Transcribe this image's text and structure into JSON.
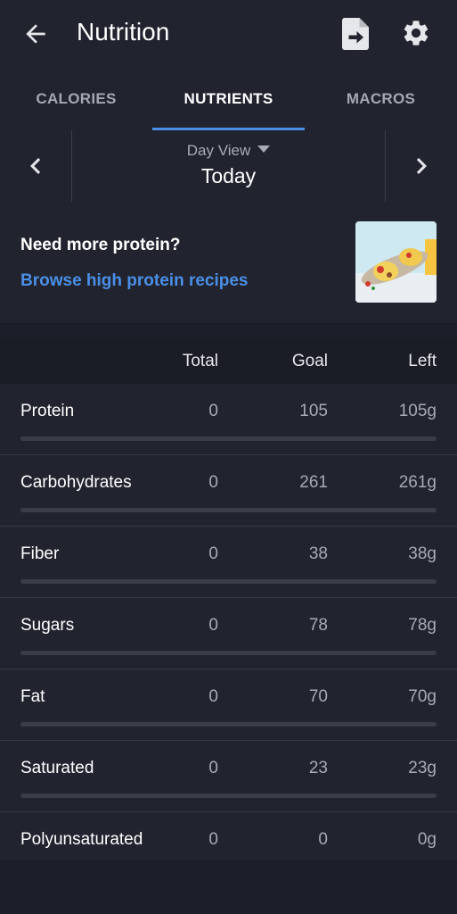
{
  "header": {
    "title": "Nutrition",
    "back_icon": "arrow-left-icon",
    "export_icon": "document-export-icon",
    "settings_icon": "gear-icon"
  },
  "tabs": [
    {
      "label": "CALORIES",
      "active": false
    },
    {
      "label": "NUTRIENTS",
      "active": true
    },
    {
      "label": "MACROS",
      "active": false
    }
  ],
  "day_selector": {
    "view_label": "Day View",
    "day": "Today"
  },
  "promo": {
    "question": "Need more protein?",
    "link": "Browse high protein recipes",
    "image": "breakfast-wrap-photo"
  },
  "table": {
    "headers": {
      "total": "Total",
      "goal": "Goal",
      "left": "Left"
    },
    "rows": [
      {
        "name": "Protein",
        "total": "0",
        "goal": "105",
        "left": "105g",
        "progress": 0
      },
      {
        "name": "Carbohydrates",
        "total": "0",
        "goal": "261",
        "left": "261g",
        "progress": 0
      },
      {
        "name": "Fiber",
        "total": "0",
        "goal": "38",
        "left": "38g",
        "progress": 0
      },
      {
        "name": "Sugars",
        "total": "0",
        "goal": "78",
        "left": "78g",
        "progress": 0
      },
      {
        "name": "Fat",
        "total": "0",
        "goal": "70",
        "left": "70g",
        "progress": 0
      },
      {
        "name": "Saturated",
        "total": "0",
        "goal": "23",
        "left": "23g",
        "progress": 0
      },
      {
        "name": "Polyunsaturated",
        "total": "0",
        "goal": "0",
        "left": "0g",
        "progress": 0
      }
    ]
  },
  "colors": {
    "background": "#1c1f2a",
    "surface": "#21242f",
    "accent": "#4a8fe7",
    "muted_text": "#a8abb5"
  }
}
